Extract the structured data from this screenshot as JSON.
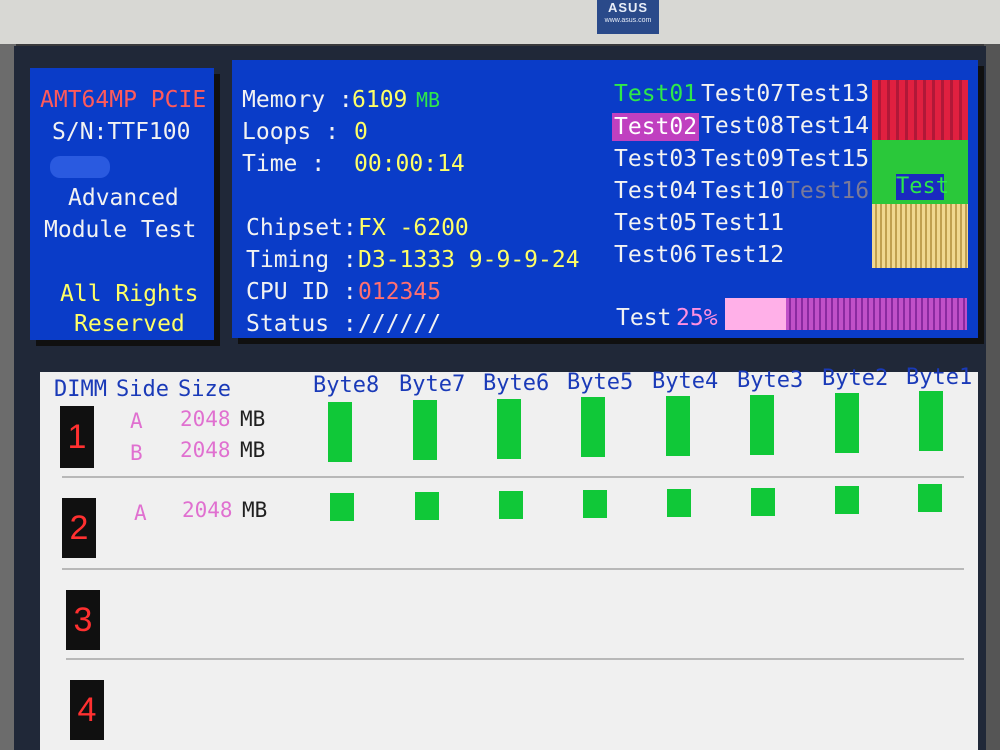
{
  "bezel": {
    "brand": "ASUS",
    "brand_sub": "www.asus.com"
  },
  "left_panel": {
    "product": "AMT64MP PCIE",
    "serial": "S/N:TTF100",
    "line1": "Advanced",
    "line2": "Module Test",
    "rights1": "All Rights",
    "rights2": "Reserved"
  },
  "info": {
    "memory_label": "Memory :",
    "memory_value": "6109",
    "memory_unit": "MB",
    "loops_label": "Loops  :",
    "loops_value": "0",
    "time_label": "Time   :",
    "time_value": "00:00:14",
    "chipset_label": "Chipset:",
    "chipset_value": "FX -6200",
    "timing_label": "Timing :",
    "timing_value": "D3-1333 9-9-9-24",
    "cpuid_label": "CPU ID :",
    "cpuid_value": "012345",
    "status_label": "Status :",
    "status_value": "//////"
  },
  "tests": {
    "col1": [
      "Test01",
      "Test02",
      "Test03",
      "Test04",
      "Test05",
      "Test06"
    ],
    "col2": [
      "Test07",
      "Test08",
      "Test09",
      "Test10",
      "Test11",
      "Test12"
    ],
    "col3": [
      "Test13",
      "Test14",
      "Test15",
      "Test16"
    ],
    "passed": "Test01",
    "current": "Test02",
    "disabled": "Test16",
    "indicator_label": "Test",
    "colors": {
      "red": "#e02040",
      "green": "#2ac83a",
      "yellow": "#f0d890",
      "highlight": "#c040c0"
    }
  },
  "progress": {
    "label": "Test",
    "value_text": "25%",
    "value": 0.25
  },
  "table": {
    "headers": {
      "dimm": "DIMM",
      "side": "Side",
      "size": "Size"
    },
    "byte_headers": [
      "Byte8",
      "Byte7",
      "Byte6",
      "Byte5",
      "Byte4",
      "Byte3",
      "Byte2",
      "Byte1"
    ],
    "dimms": [
      {
        "num": "1",
        "rows": [
          {
            "side": "A",
            "size": "2048",
            "unit": "MB"
          },
          {
            "side": "B",
            "size": "2048",
            "unit": "MB"
          }
        ]
      },
      {
        "num": "2",
        "rows": [
          {
            "side": "A",
            "size": "2048",
            "unit": "MB"
          }
        ]
      },
      {
        "num": "3",
        "rows": []
      },
      {
        "num": "4",
        "rows": []
      }
    ],
    "bar_color": "#10c838"
  }
}
